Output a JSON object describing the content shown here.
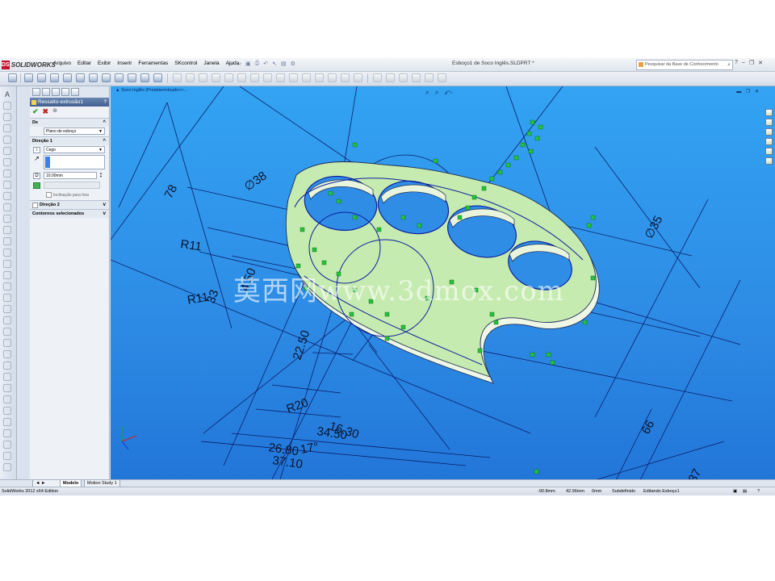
{
  "app": {
    "brand_mark": "DS",
    "brand_name": "SOLIDWORKS",
    "document_title": "Esboço1 de Soco Inglês.SLDPRT *"
  },
  "menu": [
    "Arquivo",
    "Editar",
    "Exibir",
    "Inserir",
    "Ferramentas",
    "SKcontrol",
    "Janela",
    "Ajuda"
  ],
  "search": {
    "placeholder": "Pesquisar da Base de Conhecimento"
  },
  "property_manager": {
    "title": "Ressalto-extrusão1",
    "help": "?",
    "from_section": {
      "label": "De",
      "value": "Plano de esboço"
    },
    "direction1": {
      "label": "Direção 1",
      "end_condition": "Cego",
      "depth": "10.00mm",
      "draft_outward_label": "Inclinação para fora"
    },
    "direction2": {
      "label": "Direção 2"
    },
    "selected_contours": {
      "label": "Contornos selecionados"
    }
  },
  "graphics": {
    "breadcrumb": "Soco Inglês (Predeterminado<<...",
    "watermark": "莫西网www.3dmox.com",
    "dimensions": [
      "78",
      "∅38",
      "∅35",
      "R11",
      "R11",
      "33",
      "4.50",
      "22.50",
      "R20",
      "16.30",
      "34.50",
      "17°",
      "26.80",
      "37.10",
      "30",
      "35",
      "66",
      "37",
      "13"
    ]
  },
  "bottom_tabs": [
    "Modelo",
    "Motion Study 1"
  ],
  "status": {
    "edition": "SolidWorks 2012 x64 Edition",
    "x": "-90.8mm",
    "y": "42.96mm",
    "z": "0mm",
    "state": "Subdefinido",
    "mode": "Editando Esboço1"
  },
  "colors": {
    "viewport_top": "#33a3f2",
    "viewport_bottom": "#2276d8",
    "part_face": "#c6ebb0",
    "part_side": "#eef6e6",
    "sketch_line": "#0d1f9e",
    "relation_marker": "#22c53a",
    "pm_title_bg": "#40608f"
  }
}
